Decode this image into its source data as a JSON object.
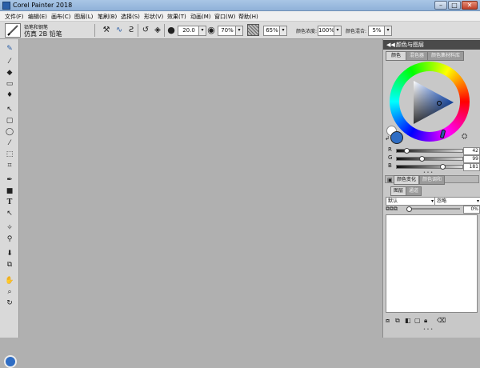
{
  "window": {
    "title": "Corel Painter 2018",
    "minimize": "–",
    "maximize": "□",
    "close": "✕"
  },
  "menu": [
    "文件(F)",
    "编辑(E)",
    "画布(C)",
    "图层(L)",
    "笔刷(B)",
    "选择(S)",
    "形状(V)",
    "效果(T)",
    "动画(M)",
    "窗口(W)",
    "帮助(H)"
  ],
  "brush": {
    "category": "铅笔和钢笔",
    "variant": "仿真 2B 铅笔"
  },
  "propbar": {
    "size_value": "20.0",
    "opacity_value": "70%",
    "grain_value": "65%",
    "resaturation_label": "颜色浓度:",
    "resaturation_value": "100%",
    "bleed_label": "颜色混合:",
    "bleed_value": "5%"
  },
  "colors": {
    "main": "#2f6dc4",
    "secondary": "#ffffff",
    "title_bg": "#9dbde0"
  },
  "panel_color": {
    "header": "颜色与图层",
    "tabs": [
      "颜色",
      "混色器",
      "颜色集材料库"
    ],
    "rgb": [
      {
        "label": "R",
        "value": "42",
        "fraction": 0.16
      },
      {
        "label": "G",
        "value": "99",
        "fraction": 0.39
      },
      {
        "label": "B",
        "value": "181",
        "fraction": 0.71
      }
    ],
    "grip": "• • •"
  },
  "panel_variability": {
    "header": "颜色变化",
    "tab2": "颜色调和"
  },
  "panel_layers": {
    "tabs": [
      "图层",
      "通道"
    ],
    "blend_mode": "默认",
    "composite": "忽略",
    "opacity_value": "0%"
  }
}
